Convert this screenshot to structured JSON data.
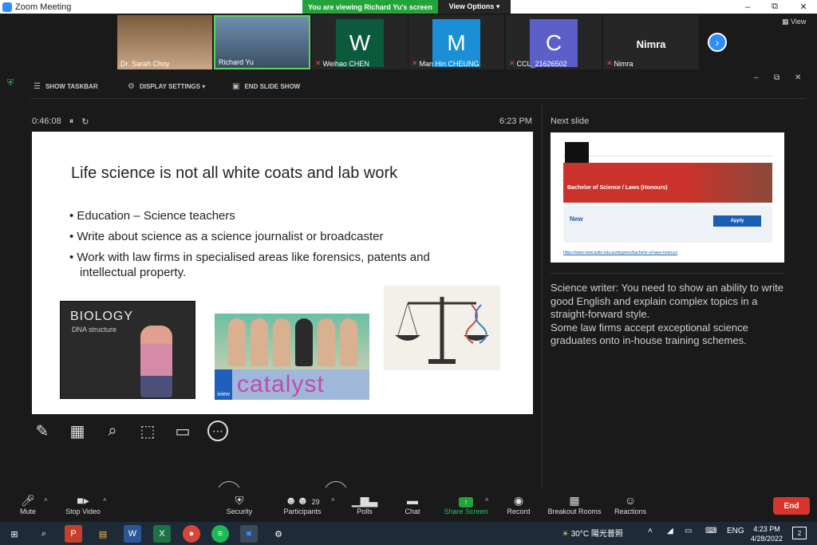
{
  "window": {
    "title": "Zoom Meeting",
    "banner": "You are viewing Richard Yu's screen",
    "view_options": "View Options ▾",
    "minimize": "–",
    "restore": "⧉",
    "close": "✕"
  },
  "gallery": {
    "participants": [
      {
        "name": "Dr. Sarah Choy",
        "initial": "",
        "avatar_color": "#8a6b4e",
        "muted": false
      },
      {
        "name": "Richard Yu",
        "initial": "",
        "avatar_color": "#4a6d8a",
        "muted": false
      },
      {
        "name": "Weihao CHEN",
        "initial": "W",
        "avatar_color": "#0b5a3e",
        "muted": true
      },
      {
        "name": "Man Hin CHEUNG",
        "initial": "M",
        "avatar_color": "#1b8fd6",
        "muted": true
      },
      {
        "name": "CCL_21626502",
        "initial": "C",
        "avatar_color": "#5b5fc7",
        "muted": true
      },
      {
        "name": "Nimra",
        "initial": "Nimra",
        "avatar_color": "#262626",
        "muted": true
      }
    ],
    "next_page": "›",
    "view_label": "View"
  },
  "presenter_toolbar": {
    "show_taskbar": "SHOW TASKBAR",
    "display_settings": "DISPLAY SETTINGS ▾",
    "end_slide_show": "END SLIDE SHOW"
  },
  "presenter": {
    "elapsed": "0:46:08",
    "pause": "⏸",
    "restart": "↻",
    "clock": "6:23 PM",
    "slide": {
      "title": "Life science is not all white coats and lab work",
      "bullets": [
        "Education – Science teachers",
        "Write about science as a science journalist or broadcaster",
        "Work with law firms in specialised areas like forensics, patents and intellectual property."
      ],
      "biology_img_title": "BIOLOGY",
      "biology_img_subtitle": "DNA structure",
      "catalyst_logo": "catalyst",
      "abc_badge": "iview"
    },
    "tools": [
      "✎",
      "▦",
      "⌕",
      "⬚",
      "▭",
      "⋯"
    ],
    "next_slide_label": "Next slide",
    "next_slide": {
      "hero_title": "Bachelor of Science / Laws (Honours)",
      "badge_value": "New",
      "apply": "Apply",
      "link": "https://www.newcastle.edu.au/degrees/bachelor-of-laws-honours"
    },
    "notes": [
      "Science writer: You need to show an ability to write good English and explain complex topics in a straight-forward style.",
      "Some law firms accept exceptional science graduates onto in-house training schemes."
    ]
  },
  "controls": {
    "mute": "Mute",
    "stop_video": "Stop Video",
    "security": "Security",
    "participants": "Participants",
    "participants_count": "29",
    "polls": "Polls",
    "chat": "Chat",
    "share_screen": "Share Screen",
    "record": "Record",
    "breakout_rooms": "Breakout Rooms",
    "reactions": "Reactions",
    "end": "End"
  },
  "taskbar": {
    "weather": "30°C 陽光普照",
    "ime": "ENG",
    "time": "4:23 PM",
    "date": "4/28/2022",
    "notifications": "2"
  }
}
